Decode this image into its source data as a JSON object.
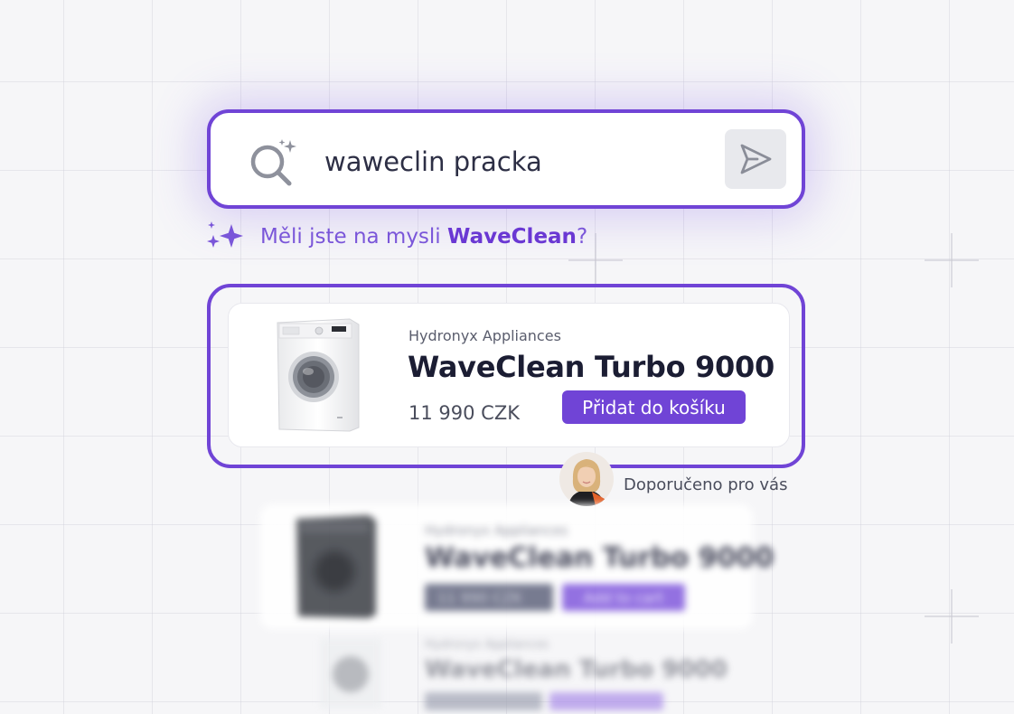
{
  "search": {
    "query": "waweclin pracka"
  },
  "suggestion": {
    "prefix": "Měli jste na mysli ",
    "term": "WaveClean",
    "suffix": "?"
  },
  "featured": {
    "brand": "Hydronyx Appliances",
    "name": "WaveClean Turbo 9000",
    "price": "11 990 CZK",
    "cart_label": "Přidat do košíku",
    "recommended_label": "Doporučeno pro vás"
  },
  "blurred_results": [
    {
      "brand": "Hydronyx Appliances",
      "name": "WaveClean Turbo 9000",
      "price": "11 990 CZK",
      "cart_label": "Add to cart"
    },
    {
      "brand": "Hydronyx Appliances",
      "name": "WaveClean Turbo 9000"
    }
  ],
  "colors": {
    "accent": "#7044d6",
    "suggestion_text": "#7a56d9",
    "send_button_bg": "#e8e9ed",
    "title_text": "#1b1d33"
  },
  "icons": {
    "search": "search-sparkle-icon",
    "send": "send-icon",
    "sparkle": "sparkles-icon"
  }
}
